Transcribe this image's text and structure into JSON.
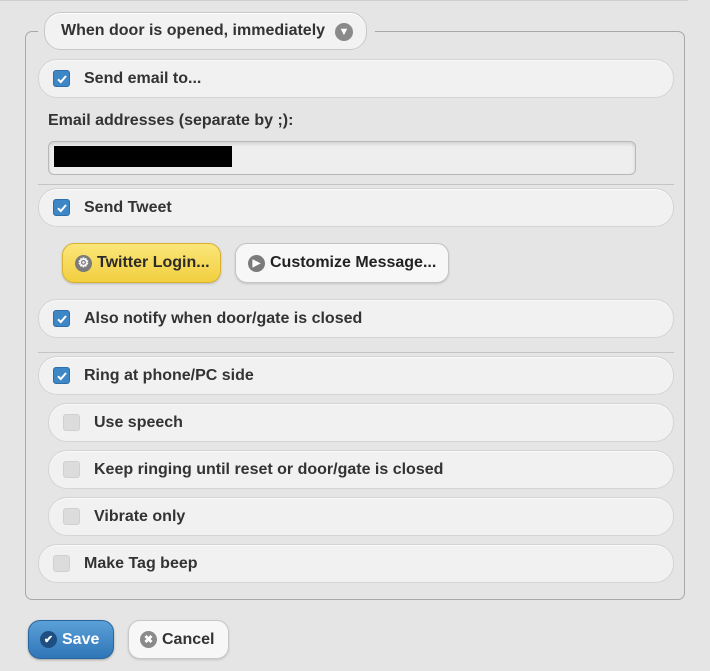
{
  "header": {
    "trigger_label": "When door is opened, immediately",
    "trigger_icon": "chevron-down-icon"
  },
  "email": {
    "checkbox_label": "Send email to...",
    "checked": true,
    "addresses_label": "Email addresses (separate by ;):",
    "addresses_value": "",
    "addresses_redacted": true
  },
  "tweet": {
    "checkbox_label": "Send Tweet",
    "checked": true,
    "twitter_login_label": "Twitter Login...",
    "twitter_login_icon": "gear-icon",
    "customize_label": "Customize Message...",
    "customize_icon": "arrow-right-icon"
  },
  "notify_closed": {
    "label": "Also notify when door/gate is closed",
    "checked": true
  },
  "ring": {
    "label": "Ring at phone/PC side",
    "checked": true,
    "options": [
      {
        "label": "Use speech",
        "checked": false
      },
      {
        "label": "Keep ringing until reset or door/gate is closed",
        "checked": false
      },
      {
        "label": "Vibrate only",
        "checked": false
      }
    ]
  },
  "tag_beep": {
    "label": "Make Tag beep",
    "checked": false
  },
  "footer": {
    "save_label": "Save",
    "save_icon": "check-icon",
    "cancel_label": "Cancel",
    "cancel_icon": "close-icon"
  },
  "colors": {
    "accent": "#3d87c6",
    "twitter_button": "#f5d74f",
    "save_button": "#3a82c2",
    "background": "#e5e5e5"
  }
}
